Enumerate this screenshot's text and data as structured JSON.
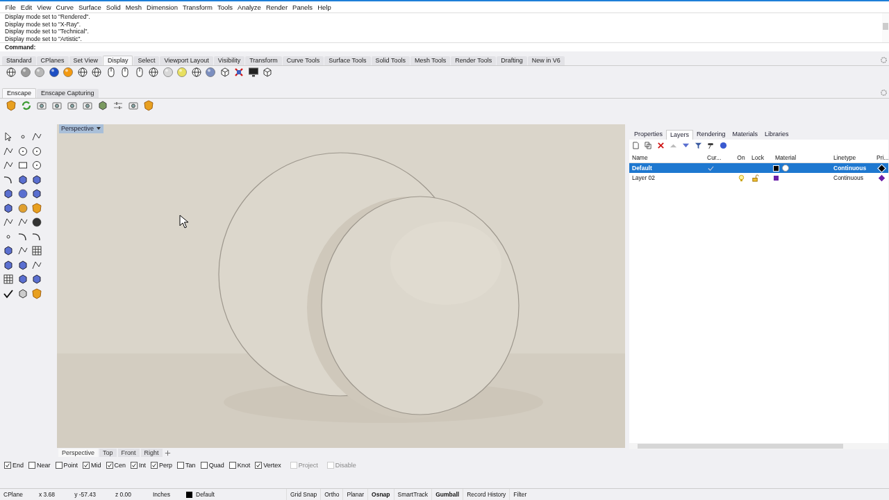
{
  "menu": [
    "File",
    "Edit",
    "View",
    "Curve",
    "Surface",
    "Solid",
    "Mesh",
    "Dimension",
    "Transform",
    "Tools",
    "Analyze",
    "Render",
    "Panels",
    "Help"
  ],
  "command_history": [
    "Display mode set to \"Rendered\".",
    "Display mode set to \"X-Ray\".",
    "Display mode set to \"Technical\".",
    "Display mode set to \"Artistic\"."
  ],
  "command_prompt": "Command:",
  "toolbar_tabs": [
    {
      "label": "Standard",
      "selected": false
    },
    {
      "label": "CPlanes",
      "selected": false
    },
    {
      "label": "Set View",
      "selected": false
    },
    {
      "label": "Display",
      "selected": true
    },
    {
      "label": "Select",
      "selected": false
    },
    {
      "label": "Viewport Layout",
      "selected": false
    },
    {
      "label": "Visibility",
      "selected": false
    },
    {
      "label": "Transform",
      "selected": false
    },
    {
      "label": "Curve Tools",
      "selected": false
    },
    {
      "label": "Surface Tools",
      "selected": false
    },
    {
      "label": "Solid Tools",
      "selected": false
    },
    {
      "label": "Mesh Tools",
      "selected": false
    },
    {
      "label": "Render Tools",
      "selected": false
    },
    {
      "label": "Drafting",
      "selected": false
    },
    {
      "label": "New in V6",
      "selected": false
    }
  ],
  "enscape_tabs": [
    {
      "label": "Enscape",
      "selected": true
    },
    {
      "label": "Enscape Capturing",
      "selected": false
    }
  ],
  "viewport": {
    "title": "Perspective"
  },
  "viewport_tabs": [
    {
      "label": "Perspective",
      "selected": true
    },
    {
      "label": "Top",
      "selected": false
    },
    {
      "label": "Front",
      "selected": false
    },
    {
      "label": "Right",
      "selected": false
    }
  ],
  "panel_tabs": [
    {
      "label": "Properties",
      "selected": false
    },
    {
      "label": "Layers",
      "selected": true
    },
    {
      "label": "Rendering",
      "selected": false
    },
    {
      "label": "Materials",
      "selected": false
    },
    {
      "label": "Libraries",
      "selected": false
    }
  ],
  "layer_columns": [
    "Name",
    "Cur...",
    "On",
    "Lock",
    "Material",
    "Linetype",
    "Pri..."
  ],
  "layers": [
    {
      "name": "Default",
      "selected": true,
      "current": true,
      "color": "#000000",
      "material": true,
      "linetype": "Continuous",
      "print": {
        "color": "#000000"
      }
    },
    {
      "name": "Layer 02",
      "selected": false,
      "current": false,
      "color": "#6a1fa8",
      "material": false,
      "linetype": "Continuous",
      "print": {
        "color": "#6a1fa8"
      }
    }
  ],
  "osnaps": [
    {
      "label": "End",
      "checked": true,
      "disabled": false
    },
    {
      "label": "Near",
      "checked": false,
      "disabled": false
    },
    {
      "label": "Point",
      "checked": false,
      "disabled": false
    },
    {
      "label": "Mid",
      "checked": true,
      "disabled": false
    },
    {
      "label": "Cen",
      "checked": true,
      "disabled": false
    },
    {
      "label": "Int",
      "checked": true,
      "disabled": false
    },
    {
      "label": "Perp",
      "checked": true,
      "disabled": false
    },
    {
      "label": "Tan",
      "checked": false,
      "disabled": false
    },
    {
      "label": "Quad",
      "checked": false,
      "disabled": false
    },
    {
      "label": "Knot",
      "checked": false,
      "disabled": false
    },
    {
      "label": "Vertex",
      "checked": true,
      "disabled": false
    },
    {
      "label": "Project",
      "checked": false,
      "disabled": true
    },
    {
      "label": "Disable",
      "checked": false,
      "disabled": true
    }
  ],
  "status": {
    "cplane": "CPlane",
    "x": "x 3.68",
    "y": "y -57.43",
    "z": "z 0.00",
    "units": "Inches",
    "layer": {
      "name": "Default",
      "color": "#000000"
    },
    "toggles": [
      {
        "label": "Grid Snap",
        "on": false
      },
      {
        "label": "Ortho",
        "on": false
      },
      {
        "label": "Planar",
        "on": false
      },
      {
        "label": "Osnap",
        "on": true
      },
      {
        "label": "SmartTrack",
        "on": false
      },
      {
        "label": "Gumball",
        "on": true
      },
      {
        "label": "Record History",
        "on": false
      },
      {
        "label": "Filter",
        "on": false
      }
    ]
  }
}
